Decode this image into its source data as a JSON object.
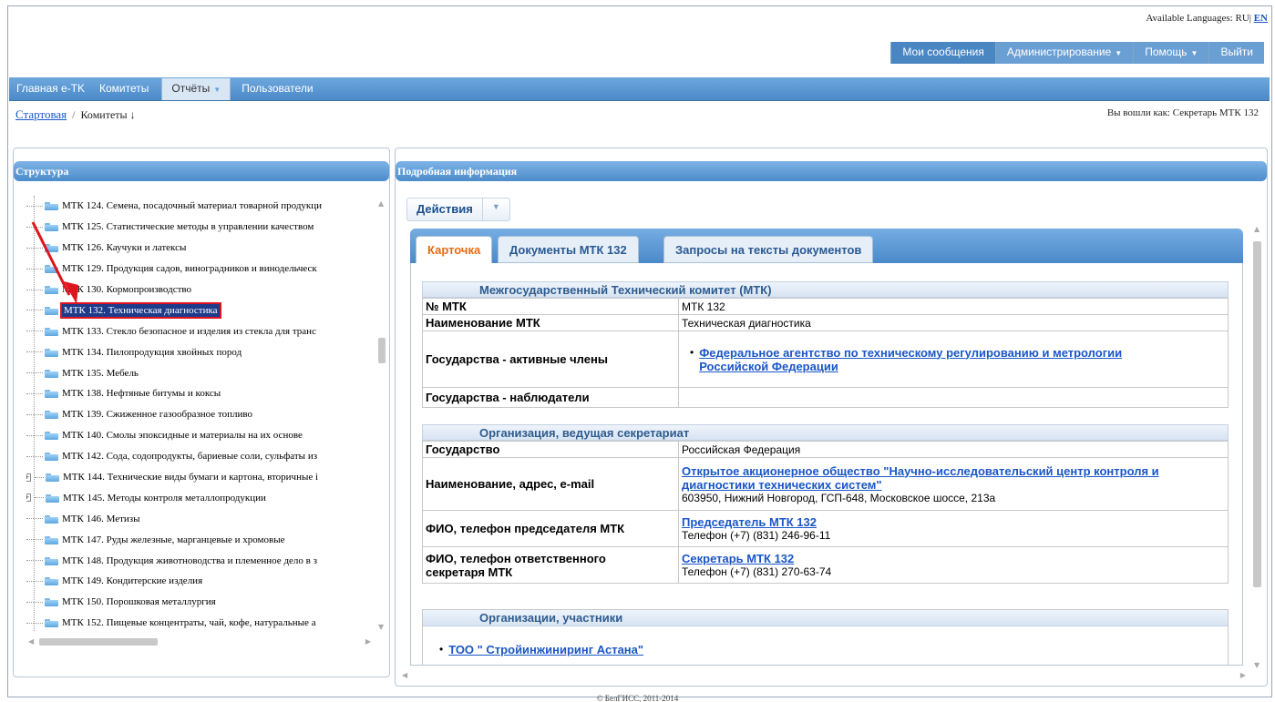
{
  "header": {
    "languages_label": "Available Languages:",
    "lang_ru": "RU",
    "lang_sep": "|",
    "lang_en": "EN",
    "nav": {
      "messages": "Мои сообщения",
      "admin": "Администрирование",
      "help": "Помощь",
      "logout": "Выйти"
    }
  },
  "mainbar": {
    "home": "Главная e-TK",
    "committees": "Комитеты",
    "reports": "Отчёты",
    "users": "Пользователи"
  },
  "breadcrumb": {
    "home": "Стартовая",
    "sep": "/",
    "current": "Комитеты",
    "arrow": "↓"
  },
  "whoami": "Вы вошли как: Секретарь МТК 132",
  "structure": {
    "title": "Структура",
    "items": [
      {
        "label": "МТК 124. Семена, посадочный материал товарной продукци",
        "expandable": false,
        "selected": false
      },
      {
        "label": "МТК 125. Статистические методы в управлении качеством",
        "expandable": false,
        "selected": false
      },
      {
        "label": "МТК 126. Каучуки и латексы",
        "expandable": false,
        "selected": false
      },
      {
        "label": "МТК 129. Продукция садов, виноградников и винодельческ",
        "expandable": false,
        "selected": false
      },
      {
        "label": "МТК 130. Кормопроизводство",
        "expandable": false,
        "selected": false
      },
      {
        "label": "МТК 132. Техническая диагностика",
        "expandable": false,
        "selected": true
      },
      {
        "label": "МТК 133. Стекло безопасное и изделия из стекла для транс",
        "expandable": false,
        "selected": false
      },
      {
        "label": "МТК 134. Пилопродукция хвойных пород",
        "expandable": false,
        "selected": false
      },
      {
        "label": "МТК 135. Мебель",
        "expandable": false,
        "selected": false
      },
      {
        "label": "МТК 138. Нефтяные битумы и коксы",
        "expandable": false,
        "selected": false
      },
      {
        "label": "МТК 139. Сжиженное газообразное топливо",
        "expandable": false,
        "selected": false
      },
      {
        "label": "МТК 140. Смолы эпоксидные и материалы на их основе",
        "expandable": false,
        "selected": false
      },
      {
        "label": "МТК 142. Сода, содопродукты, бариевые соли, сульфаты из",
        "expandable": false,
        "selected": false
      },
      {
        "label": "МТК 144. Технические виды бумаги и картона, вторичные і",
        "expandable": true,
        "selected": false
      },
      {
        "label": "МТК 145. Методы контроля металлопродукции",
        "expandable": true,
        "selected": false
      },
      {
        "label": "МТК 146. Метизы",
        "expandable": false,
        "selected": false
      },
      {
        "label": "МТК 147. Руды железные, марганцевые и хромовые",
        "expandable": false,
        "selected": false
      },
      {
        "label": "МТК 148. Продукция животноводства и племенное дело в з",
        "expandable": false,
        "selected": false
      },
      {
        "label": "МТК 149. Кондитерские изделия",
        "expandable": false,
        "selected": false
      },
      {
        "label": "МТК 150. Порошковая металлургия",
        "expandable": false,
        "selected": false
      },
      {
        "label": "МТК 152. Пищевые концентраты, чай, кофе, натуральные а",
        "expandable": false,
        "selected": false
      }
    ]
  },
  "details": {
    "title": "Подробная информация",
    "actions": "Действия",
    "tabs": [
      "Карточка",
      "Документы МТК 132",
      "Запросы на тексты документов"
    ],
    "mtk_section": {
      "title": "Межгосударственный Технический комитет (МТК)",
      "number_label": "№ МТК",
      "number_value": "МТК 132",
      "name_label": "Наименование МТК",
      "name_value": "Техническая диагностика",
      "active_label": "Государства - активные члены",
      "active_value_1": "Федеральное агентство по техническому регулированию и метрологии",
      "active_value_2": "Российской Федерации",
      "observers_label": "Государства - наблюдатели",
      "observers_value": ""
    },
    "org_section": {
      "title": "Организация, ведущая секретариат",
      "state_label": "Государство",
      "state_value": "Российская Федерация",
      "addr_label": "Наименование, адрес, e-mail",
      "org_name_1": "Открытое акционерное общество \"Научно-исследовательский центр контроля и",
      "org_name_2": "диагностики технических систем\"",
      "org_address": "603950, Нижний Новгород, ГСП-648, Московское шоссе, 213а",
      "chair_label": "ФИО, телефон председателя МТК",
      "chair_name": "Председатель МТК 132",
      "chair_phone": "Телефон (+7) (831) 246-96-11",
      "secr_label_1": "ФИО, телефон ответственного",
      "secr_label_2": "секретаря МТК",
      "secr_name": "Секретарь МТК 132",
      "secr_phone": "Телефон (+7) (831) 270-63-74"
    },
    "members_section": {
      "title": "Организации, участники",
      "items": [
        "ТОО \" Стройинжиниринг Астана\""
      ]
    }
  },
  "footer": "© БелГИСС, 2011-2014",
  "colors": {
    "header_blue": "#4a89c9",
    "selected_bg": "#1d3b8a",
    "highlight_red": "#e0141e",
    "active_tab_text": "#e86a10",
    "link": "#1a56c7"
  }
}
